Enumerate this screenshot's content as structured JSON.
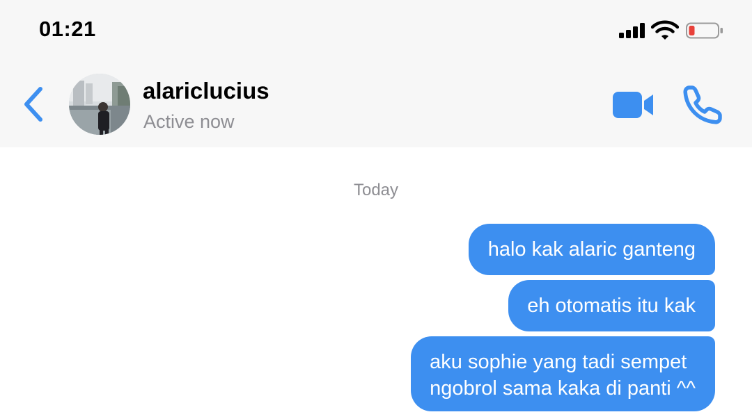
{
  "status_bar": {
    "time": "01:21",
    "signal_icon": "signal-bars-icon",
    "wifi_icon": "wifi-icon",
    "battery_icon": "battery-low-icon",
    "battery_color": "#e8413a"
  },
  "header": {
    "back_icon": "chevron-left-icon",
    "contact_name": "alariclucius",
    "contact_status": "Active now",
    "video_icon": "video-camera-icon",
    "call_icon": "phone-icon",
    "accent_color": "#3d8ff0"
  },
  "conversation": {
    "date_label": "Today",
    "messages": [
      {
        "sender": "me",
        "lines": [
          "halo kak alaric ganteng"
        ]
      },
      {
        "sender": "me",
        "lines": [
          "eh otomatis itu kak"
        ]
      },
      {
        "sender": "me",
        "lines": [
          "aku sophie yang tadi sempet",
          "ngobrol sama kaka di panti ^^"
        ]
      }
    ],
    "bubble_color": "#3d8ff0"
  }
}
